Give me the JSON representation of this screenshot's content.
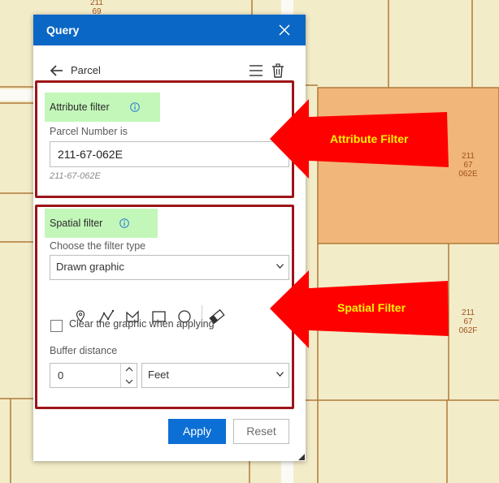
{
  "map": {
    "parcel_top": "211\n69",
    "parcel_selected": "211\n67\n062E",
    "parcel_lower": "211\n67\n062F",
    "colors": {
      "background": "#f3ecc9",
      "parcel_line": "#b07a38",
      "selected_fill": "#f1b67a"
    }
  },
  "panel": {
    "title": "Query",
    "layer_name": "Parcel",
    "attribute_filter": {
      "label": "Attribute filter",
      "field_label": "Parcel Number is",
      "value": "211-67-062E",
      "hint": "211-67-062E"
    },
    "spatial_filter": {
      "label": "Spatial filter",
      "type_label": "Choose the filter type",
      "type_value": "Drawn graphic",
      "tools": [
        "point-tool-icon",
        "polyline-tool-icon",
        "polygon-tool-icon",
        "rectangle-tool-icon",
        "circle-tool-icon",
        "eraser-icon"
      ],
      "clear_label": "Clear the graphic when applying",
      "clear_checked": false,
      "buffer_label": "Buffer distance",
      "buffer_value": "0",
      "unit_value": "Feet"
    },
    "apply_label": "Apply",
    "reset_label": "Reset",
    "colors": {
      "header": "#0b67c5",
      "apply": "#0b6fd6",
      "section_highlight": "#c3f7b9"
    }
  },
  "annotations": {
    "attribute_callout": "Attribute Filter",
    "spatial_callout": "Spatial Filter",
    "colors": {
      "arrow": "#ff0000",
      "text": "#fff200",
      "box": "#9d1418"
    }
  }
}
